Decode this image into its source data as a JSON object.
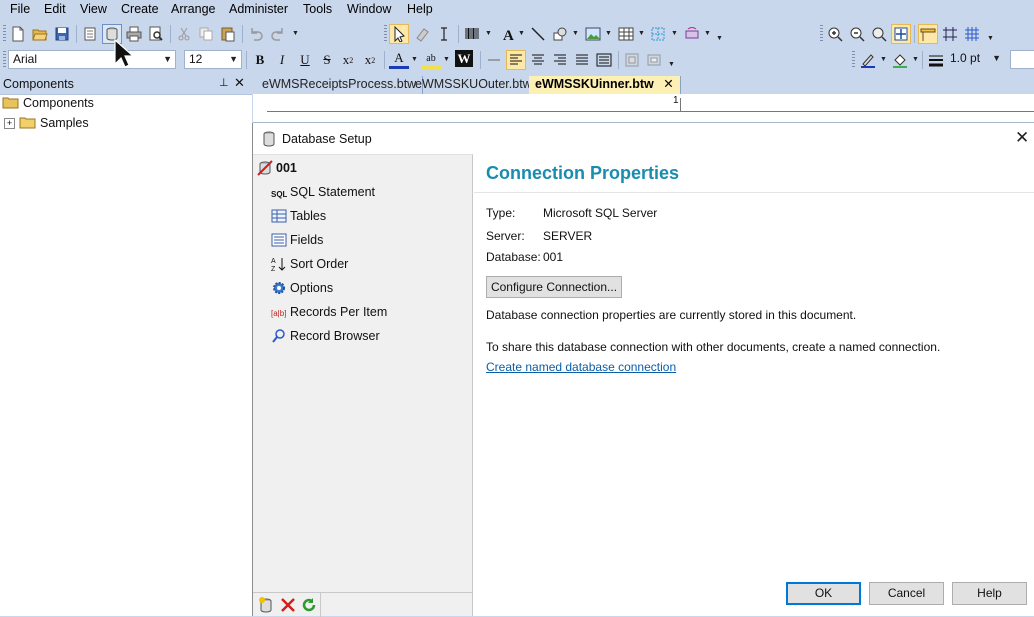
{
  "menu": [
    "File",
    "Edit",
    "View",
    "Create",
    "Arrange",
    "Administer",
    "Tools",
    "Window",
    "Help"
  ],
  "toolbar": {
    "font_name": "Arial",
    "font_size": "12",
    "line_width": "1.0 pt"
  },
  "components_panel": {
    "title": "Components",
    "tree": [
      {
        "label": "Components"
      },
      {
        "label": "Samples"
      }
    ]
  },
  "document_tabs": [
    {
      "label": "eWMSReceiptsProcess.btw",
      "active": false
    },
    {
      "label": "eWMSSKUOuter.btw",
      "active": false
    },
    {
      "label": "eWMSSKUinner.btw",
      "active": true
    }
  ],
  "ruler": {
    "mark": "1"
  },
  "dialog": {
    "title": "Database Setup",
    "nav": {
      "root": "001",
      "items": [
        {
          "label": "SQL Statement",
          "icon": "sql-icon"
        },
        {
          "label": "Tables",
          "icon": "table-icon"
        },
        {
          "label": "Fields",
          "icon": "fields-icon"
        },
        {
          "label": "Sort Order",
          "icon": "sort-icon"
        },
        {
          "label": "Options",
          "icon": "gear-icon"
        },
        {
          "label": "Records Per Item",
          "icon": "records-icon"
        },
        {
          "label": "Record Browser",
          "icon": "browser-icon"
        }
      ]
    },
    "content": {
      "heading": "Connection Properties",
      "type_label": "Type:",
      "type_value": "Microsoft SQL Server",
      "server_label": "Server:",
      "server_value": "SERVER",
      "database_label": "Database:",
      "database_value": "001",
      "configure_button": "Configure Connection...",
      "stored_text": "Database connection properties are currently stored in this document.",
      "share_text": "To share this database connection with other documents, create a named connection.",
      "named_link": "Create named database connection"
    },
    "buttons": {
      "ok": "OK",
      "cancel": "Cancel",
      "help": "Help"
    }
  },
  "colors": {
    "chrome": "#c9d7ec",
    "heading": "#1a8cae",
    "active_tab": "#fdf0b4",
    "link": "#0a5ea8"
  }
}
